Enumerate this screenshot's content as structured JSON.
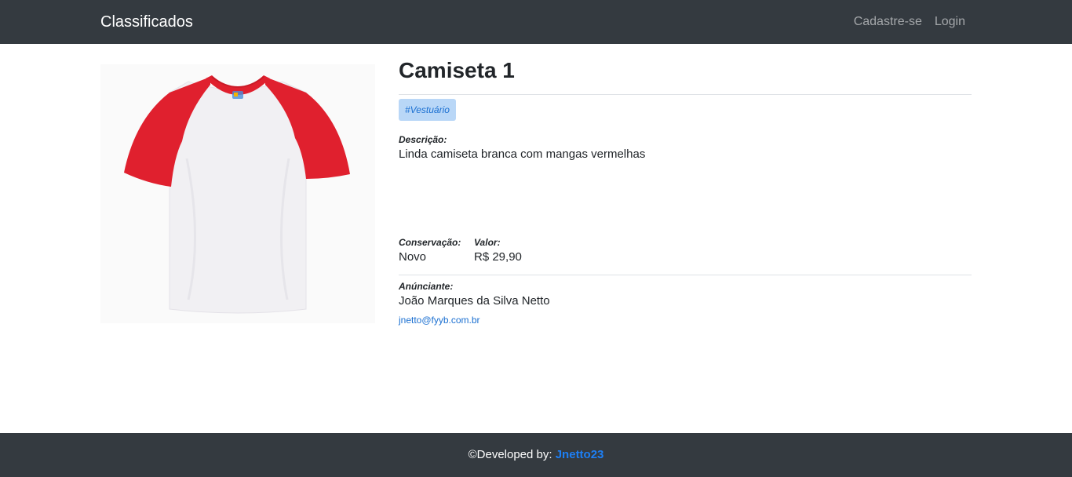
{
  "navbar": {
    "brand": "Classificados",
    "links": [
      "Cadastre-se",
      "Login"
    ]
  },
  "product": {
    "title": "Camiseta 1",
    "tag": "#Vestuário",
    "description_label": "Descrição:",
    "description": "Linda camiseta branca com mangas vermelhas",
    "condition_label": "Conservação:",
    "condition": "Novo",
    "price_label": "Valor:",
    "price": "R$ 29,90",
    "seller_label": "Anúnciante:",
    "seller_name": "João Marques da Silva Netto",
    "seller_email": "jnetto@fyyb.com.br"
  },
  "footer": {
    "text": "©Developed by: ",
    "author": "Jnetto23"
  },
  "colors": {
    "navbar_bg": "#343a40",
    "tag_bg": "#b9d7f7",
    "link": "#1a6fd1",
    "tshirt_sleeves": "#e0202e"
  }
}
